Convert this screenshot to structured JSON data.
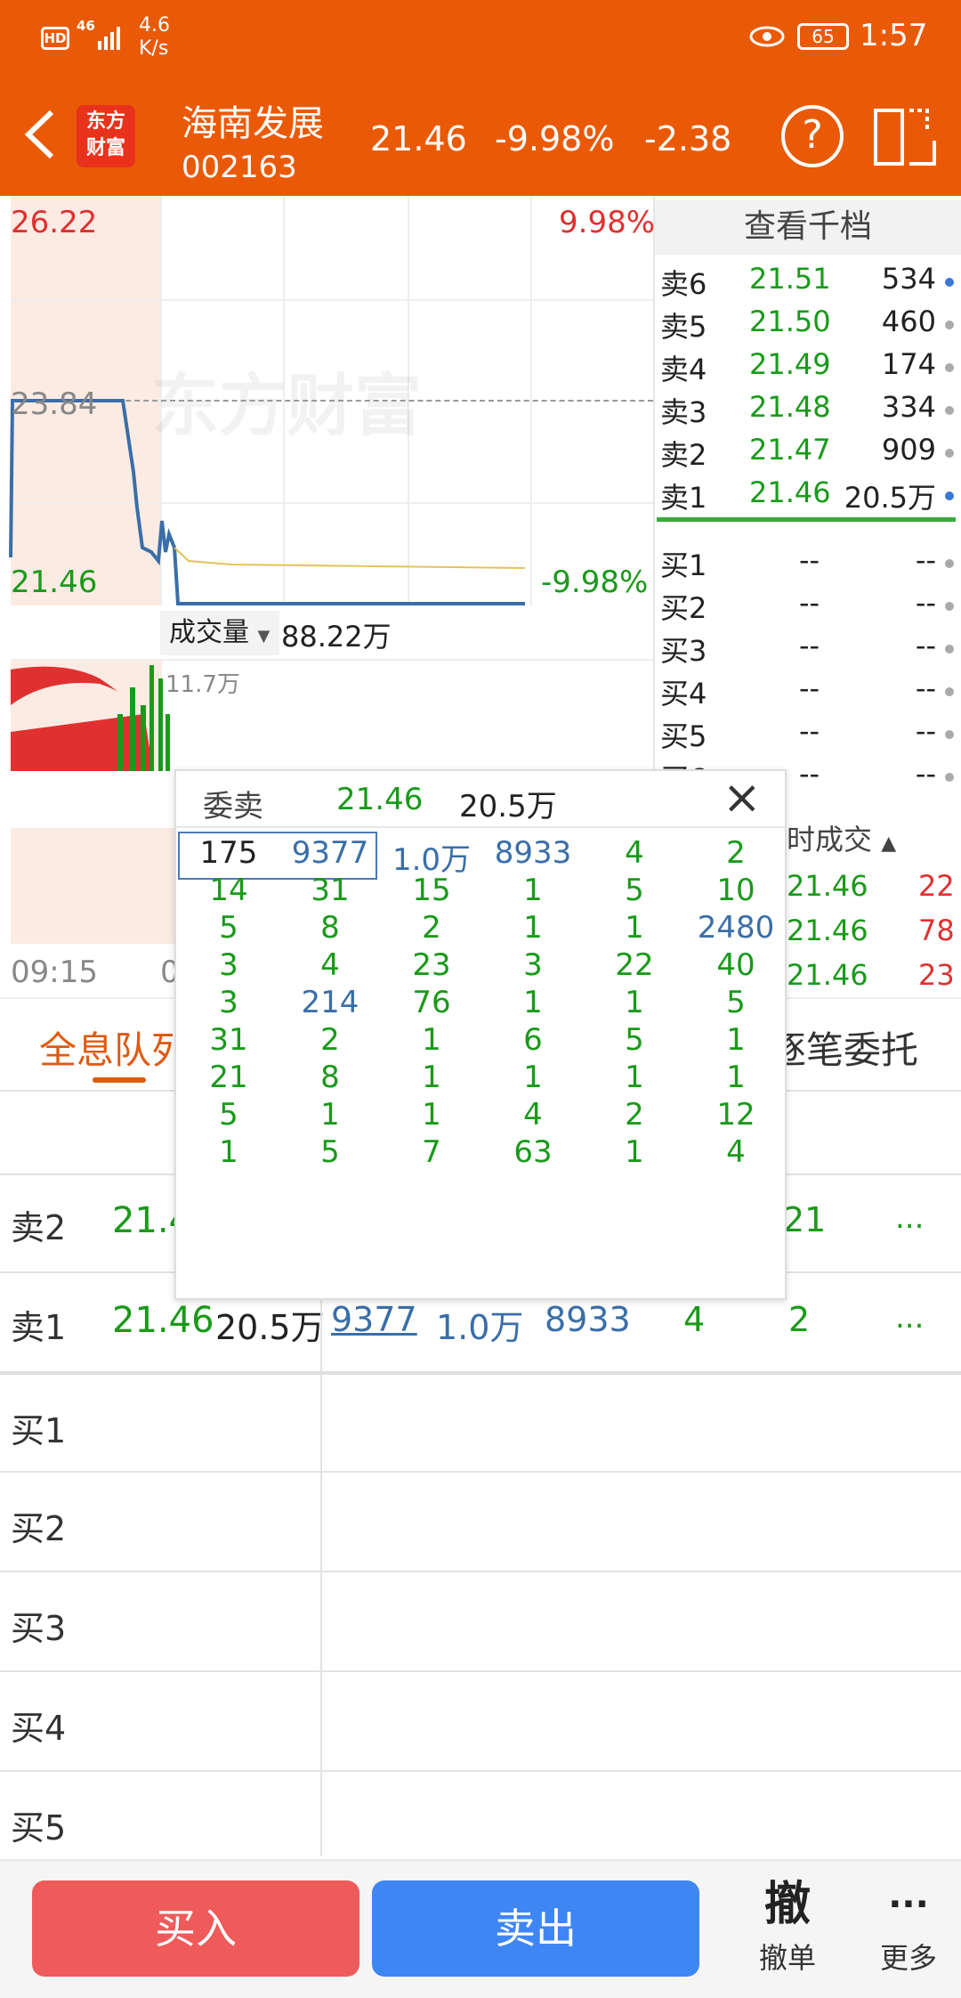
{
  "status_bar": {
    "hd": "HD",
    "network": "46",
    "speed_value": "4.6",
    "speed_unit": "K/s",
    "battery": "65",
    "time": "1:57"
  },
  "header": {
    "logo_line1": "东方",
    "logo_line2": "财富",
    "stock_name": "海南发展",
    "stock_code": "002163",
    "price": "21.46",
    "change_pct": "-9.98%",
    "change": "-2.38",
    "help_icon": "?"
  },
  "chart": {
    "high_label": "26.22",
    "high_pct": "9.98%",
    "mid_label": "23.84",
    "low_label": "21.46",
    "low_pct": "-9.98%",
    "watermark": "东方财富",
    "volume_selector": "成交量",
    "volume_value": "88.22万",
    "volume_peak": "11.7万",
    "time_start": "09:15",
    "time_next": "0",
    "colors": {
      "up": "#e03030",
      "down": "#1a9a1a",
      "price_line": "#3a6ea8",
      "avg_line": "#e6c25a"
    }
  },
  "order_book": {
    "title": "查看千档",
    "asks": [
      {
        "label": "卖6",
        "price": "21.51",
        "vol": "534"
      },
      {
        "label": "卖5",
        "price": "21.50",
        "vol": "460"
      },
      {
        "label": "卖4",
        "price": "21.49",
        "vol": "174"
      },
      {
        "label": "卖3",
        "price": "21.48",
        "vol": "334"
      },
      {
        "label": "卖2",
        "price": "21.47",
        "vol": "909"
      },
      {
        "label": "卖1",
        "price": "21.46",
        "vol": "20.5万"
      }
    ],
    "bids": [
      {
        "label": "买1",
        "price": "--",
        "vol": "--"
      },
      {
        "label": "买2",
        "price": "--",
        "vol": "--"
      },
      {
        "label": "买3",
        "price": "--",
        "vol": "--"
      },
      {
        "label": "买4",
        "price": "--",
        "vol": "--"
      },
      {
        "label": "买5",
        "price": "--",
        "vol": "--"
      },
      {
        "label": "买6",
        "price": "--",
        "vol": "--"
      }
    ],
    "trades_title": "时成交",
    "trades": [
      {
        "price": "21.46",
        "vol": "22"
      },
      {
        "price": "21.46",
        "vol": "78"
      },
      {
        "price": "21.46",
        "vol": "23"
      }
    ]
  },
  "tabs": {
    "left": "全息队列",
    "right": "逐笔委托"
  },
  "popup": {
    "title": "委卖",
    "price": "21.46",
    "volume": "20.5万",
    "close_icon": "×",
    "rows": [
      [
        "175",
        "9377",
        "1.0万",
        "8933",
        "4",
        "2"
      ],
      [
        "14",
        "31",
        "15",
        "1",
        "5",
        "10"
      ],
      [
        "5",
        "8",
        "2",
        "1",
        "1",
        "2480"
      ],
      [
        "3",
        "4",
        "23",
        "3",
        "22",
        "40"
      ],
      [
        "3",
        "214",
        "76",
        "1",
        "1",
        "5"
      ],
      [
        "31",
        "2",
        "1",
        "6",
        "5",
        "1"
      ],
      [
        "21",
        "8",
        "1",
        "1",
        "1",
        "1"
      ],
      [
        "5",
        "1",
        "1",
        "4",
        "2",
        "12"
      ],
      [
        "1",
        "5",
        "7",
        "63",
        "1",
        "4"
      ]
    ]
  },
  "queue": {
    "sell2": {
      "label": "卖2",
      "price": "21.4",
      "tail": "21",
      "more": "..."
    },
    "sell1": {
      "label": "卖1",
      "price": "21.46",
      "volume": "20.5万",
      "orders": [
        "9377",
        "1.0万",
        "8933",
        "4",
        "2"
      ],
      "more": "..."
    },
    "buys": [
      "买1",
      "买2",
      "买3",
      "买4",
      "买5"
    ]
  },
  "bottom_bar": {
    "buy": "买入",
    "sell": "卖出",
    "cancel_glyph": "撤",
    "cancel": "撤单",
    "more_glyph": "···",
    "more": "更多"
  }
}
